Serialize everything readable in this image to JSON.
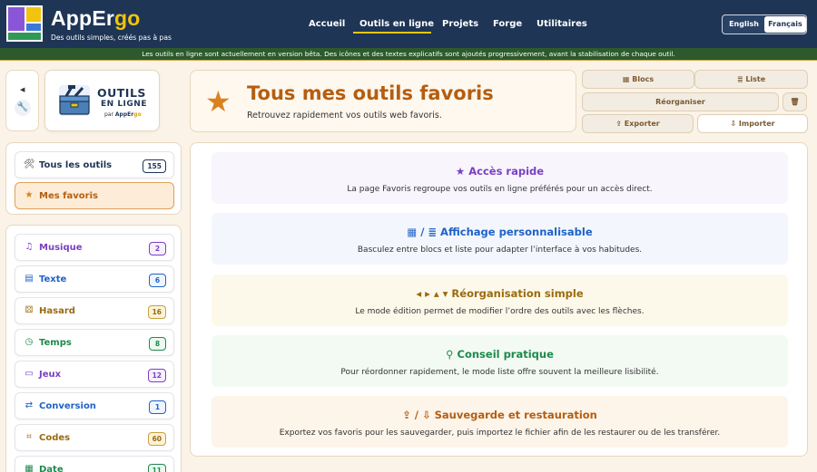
{
  "brand": {
    "name_part1": "App",
    "name_part2": "Er",
    "name_part3": "go",
    "tagline": "Des outils simples, créés pas à pas"
  },
  "nav": {
    "items": [
      "Accueil",
      "Outils en ligne",
      "Projets",
      "Forge",
      "Utilitaires"
    ],
    "active": "Outils en ligne"
  },
  "lang": {
    "en": "English",
    "fr": "Français",
    "active": "Français"
  },
  "banner": "Les outils en ligne sont actuellement en version bêta. Des icônes et des textes explicatifs sont ajoutés progressivement, avant la stabilisation de chaque outil.",
  "tools_card": {
    "line1": "OUTILS",
    "line2": "EN LIGNE",
    "by": "par",
    "brand1": "AppEr",
    "brand2": "go"
  },
  "hero": {
    "title": "Tous mes outils favoris",
    "subtitle": "Retrouvez rapidement vos outils web favoris."
  },
  "toolbar": {
    "blocs": "Blocs",
    "liste": "Liste",
    "reorganiser": "Réorganiser",
    "exporter": "Exporter",
    "importer": "Importer"
  },
  "sidebar": {
    "top": [
      {
        "label": "Tous les outils",
        "count": "155",
        "icon": "tools-icon"
      },
      {
        "label": "Mes favoris",
        "icon": "star-icon",
        "active": true
      }
    ],
    "categories": [
      {
        "label": "Musique",
        "count": "2",
        "color": "#7b3fc4",
        "icon": "music-icon"
      },
      {
        "label": "Texte",
        "count": "6",
        "color": "#1f62c7",
        "icon": "document-icon"
      },
      {
        "label": "Hasard",
        "count": "16",
        "color": "#9a6a10",
        "icon": "dice-icon"
      },
      {
        "label": "Temps",
        "count": "8",
        "color": "#1d8a4a",
        "icon": "clock-icon"
      },
      {
        "label": "Jeux",
        "count": "12",
        "color": "#7b3fc4",
        "icon": "gamepad-icon"
      },
      {
        "label": "Conversion",
        "count": "1",
        "color": "#1f62c7",
        "icon": "swap-icon"
      },
      {
        "label": "Codes",
        "count": "60",
        "color": "#9a6a10",
        "icon": "code-icon"
      },
      {
        "label": "Date",
        "count": "11",
        "color": "#1d8a4a",
        "icon": "calendar-icon"
      }
    ]
  },
  "features": [
    {
      "title": "★ Accès rapide",
      "desc": "La page Favoris regroupe vos outils en ligne préférés pour un accès direct.",
      "color": "#7b3fc4",
      "bg": "#f8f5fd"
    },
    {
      "title": "▦ / ≣ Affichage personnalisable",
      "desc": "Basculez entre blocs et liste pour adapter l’interface à vos habitudes.",
      "color": "#1f62c7",
      "bg": "#f3f7fd"
    },
    {
      "title": "◂ ▸ ▴ ▾ Réorganisation simple",
      "desc": "Le mode édition permet de modifier l’ordre des outils avec les flèches.",
      "color": "#9a6a10",
      "bg": "#fdf9ea"
    },
    {
      "title": "⚲ Conseil pratique",
      "desc": "Pour réordonner rapidement, le mode liste offre souvent la meilleure lisibilité.",
      "color": "#1d8a4a",
      "bg": "#f3faf4"
    },
    {
      "title": "⇪ / ⇩ Sauvegarde et restauration",
      "desc": "Exportez vos favoris pour les sauvegarder, puis importez le fichier afin de les restaurer ou de les transférer.",
      "color": "#b55e10",
      "bg": "#fdf4ea"
    }
  ]
}
